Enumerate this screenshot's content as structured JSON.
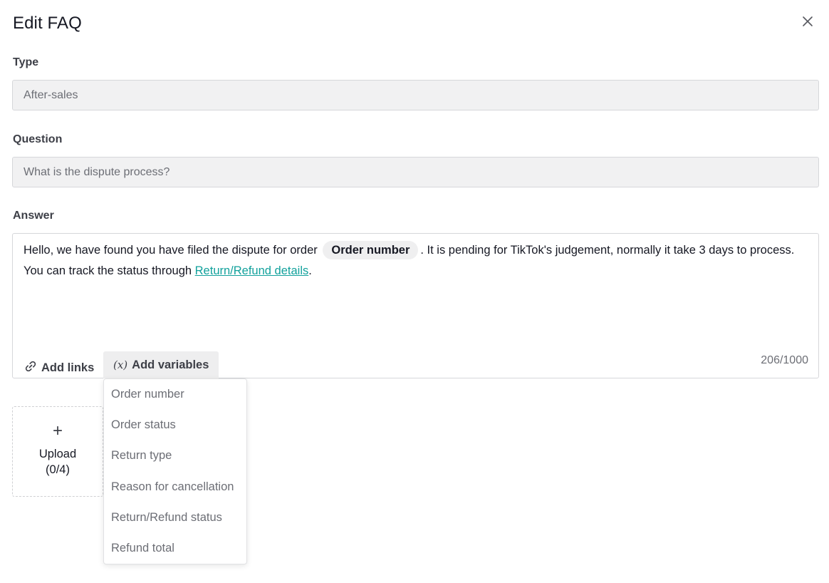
{
  "modal": {
    "title": "Edit FAQ"
  },
  "type": {
    "label": "Type",
    "value": "After-sales"
  },
  "question": {
    "label": "Question",
    "value": "What is the dispute process?"
  },
  "answer": {
    "label": "Answer",
    "text_before": "Hello, we have found you have filed the dispute for order",
    "variable": "Order number",
    "text_middle": ". It is pending for TikTok's judgement, normally it take 3 days to process. You can track the status through ",
    "link_text": "Return/Refund details",
    "text_after": ".",
    "counter": "206/1000"
  },
  "toolbar": {
    "add_links_label": "Add links",
    "add_variables_symbol": "(x)",
    "add_variables_label": "Add variables"
  },
  "variables_menu": {
    "items": [
      "Order number",
      "Order status",
      "Return type",
      "Reason for cancellation",
      "Return/Refund status",
      "Refund total"
    ]
  },
  "upload": {
    "label": "Upload",
    "count": "(0/4)"
  },
  "icons": {
    "close": "close-icon",
    "link": "link-icon",
    "plus": "plus-icon"
  }
}
